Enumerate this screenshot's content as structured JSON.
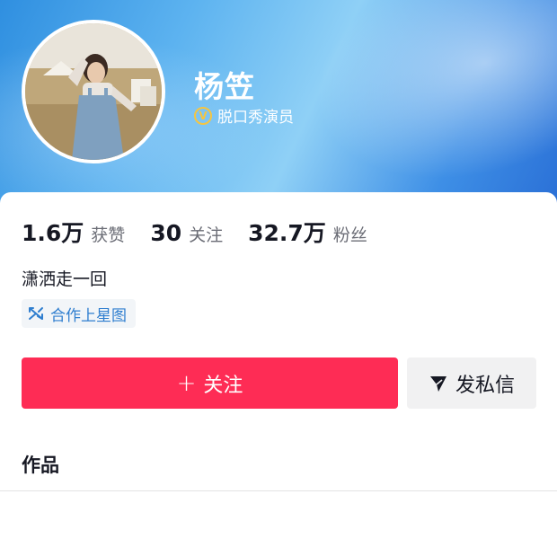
{
  "profile": {
    "name": "杨笠",
    "verification_label": "脱口秀演员",
    "verify_badge": "V"
  },
  "stats": [
    {
      "value": "1.6万",
      "label": "获赞"
    },
    {
      "value": "30",
      "label": "关注"
    },
    {
      "value": "32.7万",
      "label": "粉丝"
    }
  ],
  "bio": "潇洒走一回",
  "tag": {
    "label": "合作上星图"
  },
  "actions": {
    "follow_label": "关注",
    "follow_plus": "+",
    "message_label": "发私信"
  },
  "tabs": {
    "works_label": "作品"
  },
  "colors": {
    "accent": "#fe2c55",
    "tag_text": "#2f7ecf",
    "verify_badge": "#f5c542"
  }
}
